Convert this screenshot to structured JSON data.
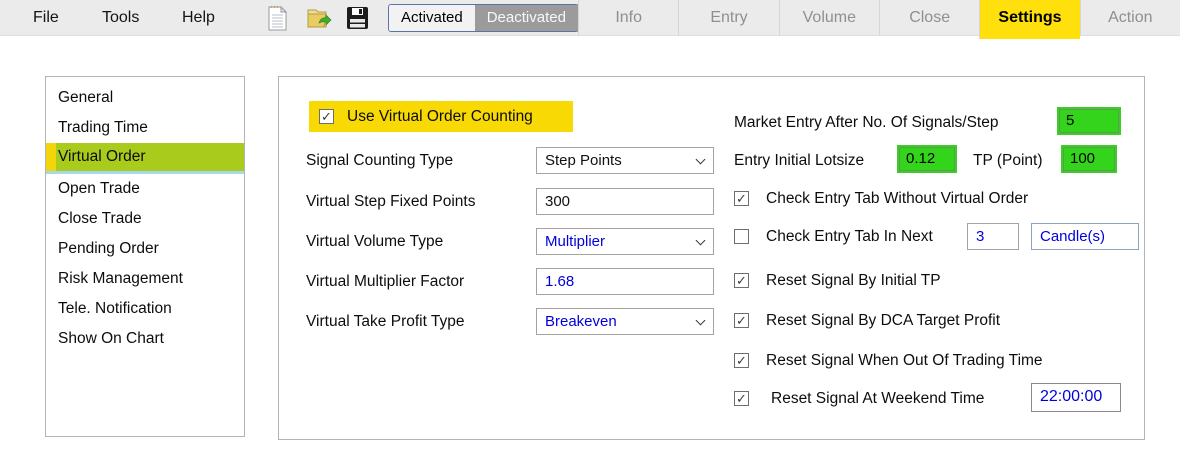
{
  "menubar": {
    "menus": [
      {
        "label": "File"
      },
      {
        "label": "Tools"
      },
      {
        "label": "Help"
      }
    ],
    "toolbar_icons": [
      {
        "name": "new-file"
      },
      {
        "name": "open-file"
      },
      {
        "name": "save"
      }
    ],
    "toggle": {
      "activated_label": "Activated",
      "deactivated_label": "Deactivated",
      "state": "Activated"
    }
  },
  "tabs": [
    {
      "label": "Info",
      "active": false
    },
    {
      "label": "Entry",
      "active": false
    },
    {
      "label": "Volume",
      "active": false
    },
    {
      "label": "Close",
      "active": false
    },
    {
      "label": "Settings",
      "active": true
    },
    {
      "label": "Action",
      "active": false
    }
  ],
  "sidebar": {
    "items": [
      {
        "label": "General",
        "active": false
      },
      {
        "label": "Trading Time",
        "active": false
      },
      {
        "label": "Virtual Order",
        "active": true
      },
      {
        "label": "Open Trade",
        "active": false
      },
      {
        "label": "Close Trade",
        "active": false
      },
      {
        "label": "Pending Order",
        "active": false
      },
      {
        "label": "Risk Management",
        "active": false
      },
      {
        "label": "Tele. Notification",
        "active": false
      },
      {
        "label": "Show On Chart",
        "active": false
      }
    ]
  },
  "panel": {
    "header_check": {
      "label": "Use Virtual Order Counting",
      "checked": true,
      "mark": "✓",
      "highlighted": true
    },
    "fields": [
      {
        "label": "Signal Counting Type",
        "value": "Step Points",
        "type": "select",
        "highlight": "yellow"
      },
      {
        "label": "Virtual Step Fixed Points",
        "value": "300",
        "type": "input",
        "highlight": "yellow"
      },
      {
        "label": "Virtual Volume Type",
        "value": "Multiplier",
        "type": "select",
        "highlight": "none"
      },
      {
        "label": "Virtual Multiplier Factor",
        "value": "1.68",
        "type": "input",
        "highlight": "none"
      },
      {
        "label": "Virtual Take Profit Type",
        "value": "Breakeven",
        "type": "select",
        "highlight": "none"
      }
    ],
    "right": {
      "market_entry": {
        "label": "Market Entry After No. Of Signals/Step",
        "value": "5",
        "highlight": "green"
      },
      "lotsize": {
        "label": "Entry Initial Lotsize",
        "value": "0.12",
        "highlight": "green"
      },
      "tp": {
        "label": "TP (Point)",
        "value": "100",
        "highlight": "green"
      },
      "checks": [
        {
          "label": "Check Entry Tab Without Virtual Order",
          "checked": true,
          "mark": "✓"
        },
        {
          "label": "Check Entry Tab In Next",
          "checked": false,
          "mark": "",
          "value": "3",
          "suffix": "Candle(s)"
        },
        {
          "label": "Reset Signal By Initial TP",
          "checked": true,
          "mark": "✓"
        },
        {
          "label": "Reset Signal By DCA Target Profit",
          "checked": true,
          "mark": "✓"
        },
        {
          "label": "Reset Signal When Out Of Trading Time",
          "checked": true,
          "mark": "✓"
        },
        {
          "label": "Reset Signal At Weekend Time",
          "checked": true,
          "mark": "✓",
          "value": "22:00:00"
        }
      ]
    }
  },
  "colors": {
    "highlight_yellow": "#f8d903",
    "tab_active_yellow": "#ffe00d",
    "highlight_green": "#35d41c",
    "sidebar_active_green": "#a9cb1b",
    "value_blue": "#0000dd"
  }
}
